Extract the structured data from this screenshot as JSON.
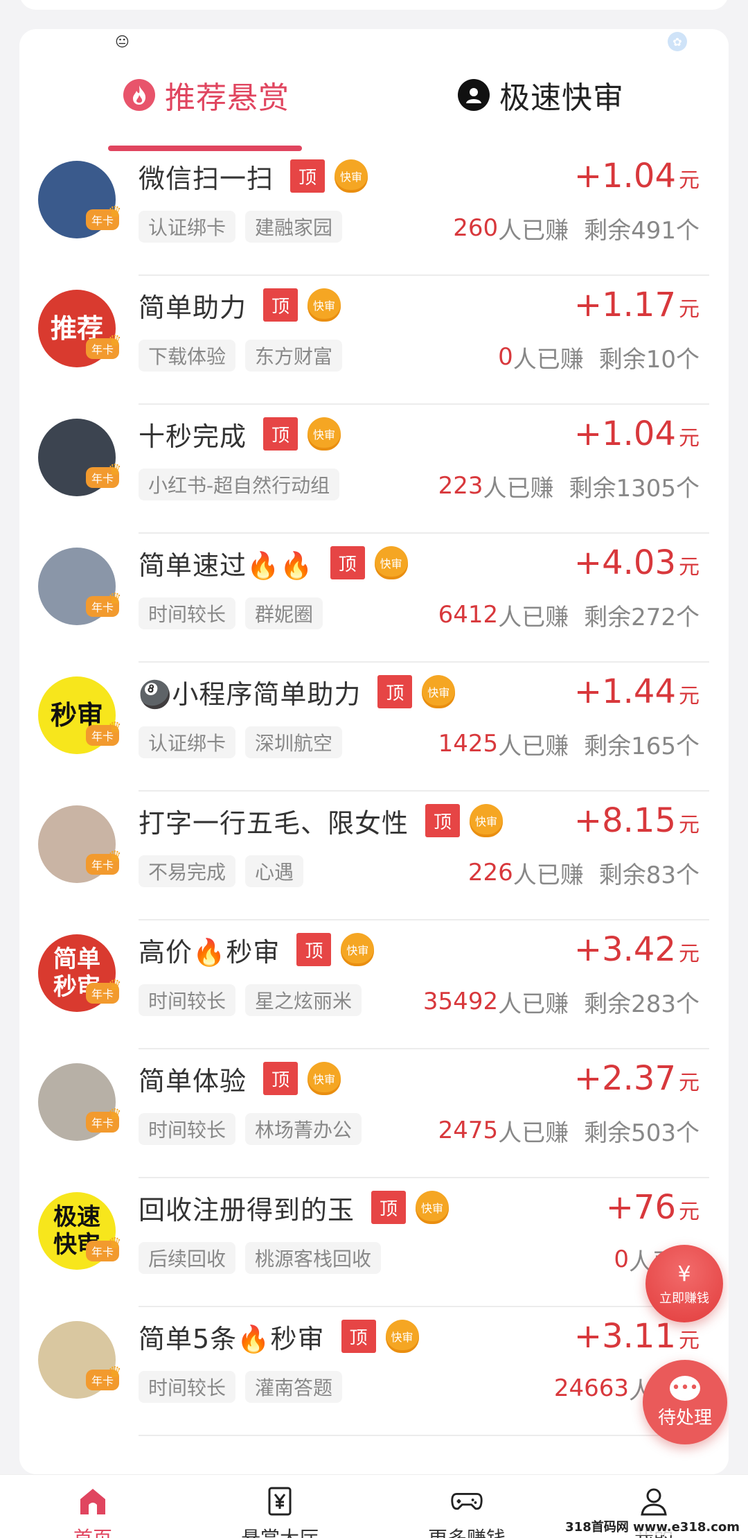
{
  "tabs": [
    {
      "label": "推荐悬赏",
      "icon": "flame-icon",
      "active": true
    },
    {
      "label": "极速快审",
      "icon": "user-icon",
      "active": false
    }
  ],
  "badges": {
    "top": "顶",
    "fast": "快审",
    "year_card": "年卡"
  },
  "units": {
    "yuan": "元",
    "earned_suffix": "人已赚",
    "remain_prefix": "剩余",
    "remain_suffix": "个"
  },
  "tasks": [
    {
      "title": "微信扫一扫",
      "price": "+1.04",
      "tags": [
        "认证绑卡",
        "建融家园"
      ],
      "earned": "260",
      "remain": "491",
      "avatar_text": "",
      "avatar_color": "#3a5a8c"
    },
    {
      "title": "简单助力",
      "price": "+1.17",
      "tags": [
        "下载体验",
        "东方财富"
      ],
      "earned": "0",
      "remain": "10",
      "avatar_text": "推荐",
      "avatar_color": "#d93a2f"
    },
    {
      "title": "十秒完成",
      "price": "+1.04",
      "tags": [
        "小红书-超自然行动组"
      ],
      "earned": "223",
      "remain": "1305",
      "avatar_text": "",
      "avatar_color": "#3c4450"
    },
    {
      "title": "简单速过🔥🔥",
      "price": "+4.03",
      "tags": [
        "时间较长",
        "群妮圈"
      ],
      "earned": "6412",
      "remain": "272",
      "avatar_text": "",
      "avatar_color": "#8a96a8"
    },
    {
      "title": "🎱小程序简单助力",
      "price": "+1.44",
      "tags": [
        "认证绑卡",
        "深圳航空"
      ],
      "earned": "1425",
      "remain": "165",
      "avatar_text": "秒审",
      "avatar_color": "#f7e61c"
    },
    {
      "title": "打字一行五毛、限女性",
      "price": "+8.15",
      "tags": [
        "不易完成",
        "心遇"
      ],
      "earned": "226",
      "remain": "83",
      "avatar_text": "",
      "avatar_color": "#c9b4a4"
    },
    {
      "title": "高价🔥秒审",
      "price": "+3.42",
      "tags": [
        "时间较长",
        "星之炫丽米"
      ],
      "earned": "35492",
      "remain": "283",
      "avatar_text": "简单秒审",
      "avatar_color": "#d93a2f"
    },
    {
      "title": "简单体验",
      "price": "+2.37",
      "tags": [
        "时间较长",
        "林场菁办公"
      ],
      "earned": "2475",
      "remain": "503",
      "avatar_text": "",
      "avatar_color": "#b7b0a6"
    },
    {
      "title": "回收注册得到的玉",
      "price": "+76",
      "tags": [
        "后续回收",
        "桃源客栈回收"
      ],
      "earned": "0",
      "remain": "",
      "avatar_text": "极速快审",
      "avatar_color": "#f7e61c"
    },
    {
      "title": "简单5条🔥秒审",
      "price": "+3.11",
      "tags": [
        "时间较长",
        "灌南答题"
      ],
      "earned": "24663",
      "remain": "",
      "avatar_text": "",
      "avatar_color": "#d9c7a0"
    }
  ],
  "fab": {
    "earn_symbol": "¥",
    "earn_label": "立即赚钱",
    "pending_label": "待处理"
  },
  "nav": [
    {
      "label": "首页",
      "icon": "home-icon"
    },
    {
      "label": "悬赏大厅",
      "icon": "yen-icon"
    },
    {
      "label": "更多赚钱",
      "icon": "gamepad-icon"
    },
    {
      "label": "我的",
      "icon": "profile-icon"
    }
  ],
  "watermark": "318首码网 www.e318.com",
  "colors": {
    "accent": "#e0455f",
    "price": "#d8383c",
    "fast_badge": "#f5a623",
    "top_badge": "#e64545"
  }
}
